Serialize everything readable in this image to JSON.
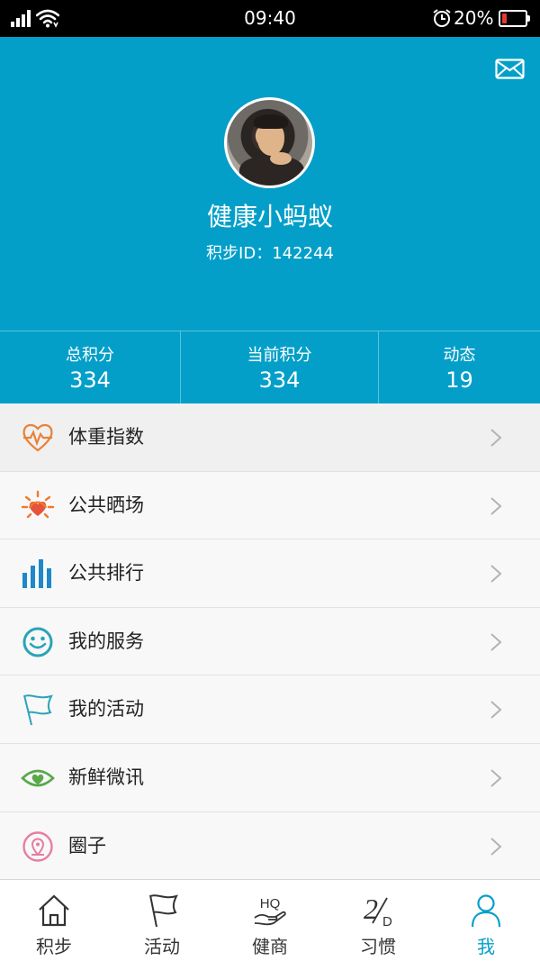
{
  "status_bar": {
    "time": "09:40",
    "battery_percent_text": "20%",
    "battery_level": 0.2
  },
  "profile": {
    "name": "健康小蚂蚁",
    "id_text": "积步ID：142244"
  },
  "stats": [
    {
      "label": "总积分",
      "value": "334"
    },
    {
      "label": "当前积分",
      "value": "334"
    },
    {
      "label": "动态",
      "value": "19"
    }
  ],
  "menu": [
    {
      "label": "体重指数",
      "icon": "heart-pulse-icon",
      "color": "#e8823a"
    },
    {
      "label": "公共晒场",
      "icon": "sun-heart-icon",
      "color": "#f07a2e"
    },
    {
      "label": "公共排行",
      "icon": "bar-chart-icon",
      "color": "#1e88c8"
    },
    {
      "label": "我的服务",
      "icon": "smiley-icon",
      "color": "#2aa3b8"
    },
    {
      "label": "我的活动",
      "icon": "flag-icon",
      "color": "#2aa3b8"
    },
    {
      "label": "新鲜微讯",
      "icon": "eye-heart-icon",
      "color": "#5aa84a"
    },
    {
      "label": "圈子",
      "icon": "location-circle-icon",
      "color": "#e77da0"
    }
  ],
  "tabs": [
    {
      "label": "积步",
      "icon": "home-icon",
      "active": false
    },
    {
      "label": "活动",
      "icon": "flag-icon",
      "active": false
    },
    {
      "label": "健商",
      "icon": "hq-hand-icon",
      "icon_text": "HQ",
      "active": false
    },
    {
      "label": "习惯",
      "icon": "21d-icon",
      "icon_text_main": "2",
      "icon_text_sub": "D",
      "active": false
    },
    {
      "label": "我",
      "icon": "person-icon",
      "active": true
    }
  ],
  "colors": {
    "primary": "#049fc9",
    "battery_low": "#e53935"
  }
}
